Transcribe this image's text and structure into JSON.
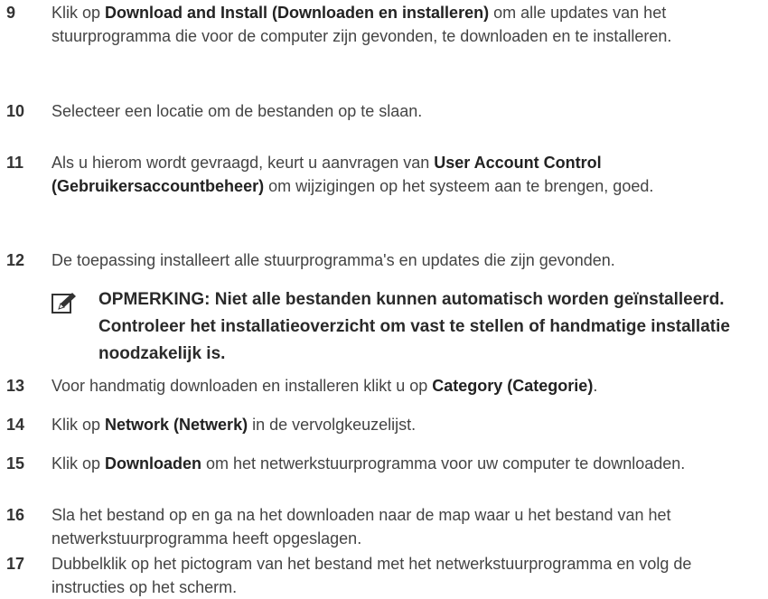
{
  "steps": [
    {
      "number": "9",
      "pre": "Klik op ",
      "bold": "Download and Install (Downloaden en installeren)",
      "post": " om alle updates van het stuurprogramma die voor de computer zijn gevonden, te downloaden en te installeren."
    },
    {
      "number": "10",
      "text": "Selecteer een locatie om de bestanden op te slaan."
    },
    {
      "number": "11",
      "pre": "Als u hierom wordt gevraagd, keurt u aanvragen van ",
      "bold": "User Account Control (Gebruikersaccountbeheer)",
      "post": " om wijzigingen op het systeem aan te brengen, goed."
    },
    {
      "number": "12",
      "text": "De toepassing installeert alle stuurprogramma's en updates die zijn gevonden."
    },
    {
      "number": "13",
      "pre": "Voor handmatig downloaden en installeren klikt u op ",
      "bold": "Category (Categorie)",
      "post": "."
    },
    {
      "number": "14",
      "pre": "Klik op ",
      "bold": "Network (Netwerk)",
      "post": " in de vervolgkeuzelijst."
    },
    {
      "number": "15",
      "pre": "Klik op ",
      "bold": "Downloaden",
      "post": " om het netwerkstuurprogramma voor uw computer te downloaden."
    },
    {
      "number": "16",
      "text": "Sla het bestand op en ga na het downloaden naar de map waar u het bestand van het netwerkstuurprogramma heeft opgeslagen."
    },
    {
      "number": "17",
      "text": "Dubbelklik op het pictogram van het bestand met het netwerkstuurprogramma en volg de instructies op het scherm."
    }
  ],
  "note": {
    "icon": "pencil-note-icon",
    "text": "OPMERKING: Niet alle bestanden kunnen automatisch worden geïnstalleerd. Controleer het installatieoverzicht om vast te stellen of handmatige installatie noodzakelijk is."
  }
}
